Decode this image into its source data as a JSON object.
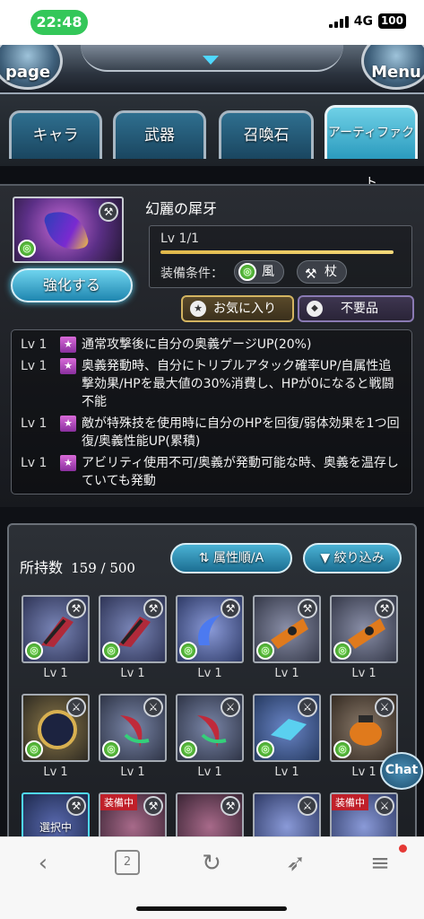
{
  "status_bar": {
    "time": "22:48",
    "network": "4G",
    "battery": "100"
  },
  "header": {
    "left_button": "page",
    "right_button": "Menu"
  },
  "tabs": [
    {
      "label": "キャラ"
    },
    {
      "label": "武器"
    },
    {
      "label": "召喚石"
    },
    {
      "label": "アーティファクト",
      "active": true
    }
  ],
  "detail": {
    "name": "幻麗の犀牙",
    "level": "Lv 1/1",
    "equip_label": "装備条件：",
    "conditions": [
      {
        "icon": "wind-element-icon",
        "label": "風"
      },
      {
        "icon": "staff-weapon-icon",
        "label": "杖"
      }
    ],
    "enhance_button": "強化する",
    "favorite_button": "お気に入り",
    "unneeded_button": "不要品",
    "skills": [
      {
        "lv": "Lv 1",
        "text": "通常攻撃後に自分の奥義ゲージUP(20%)"
      },
      {
        "lv": "Lv 1",
        "text": "奥義発動時、自分にトリプルアタック確率UP/自属性追撃効果/HPを最大値の30%消費し、HPが0になると戦闘不能"
      },
      {
        "lv": "Lv 1",
        "text": "敵が特殊技を使用時に自分のHPを回復/弱体効果を1つ回復/奥義性能UP(累積)"
      },
      {
        "lv": "Lv 1",
        "text": "アビリティ使用不可/奥義が発動可能な時、奥義を温存していても発動"
      }
    ]
  },
  "inventory": {
    "count_label": "所持数",
    "count": "159 / 500",
    "sort_button": "属性順/A",
    "filter_button": "絞り込み",
    "items": [
      {
        "lv": "Lv 1",
        "icon": "fang-blade-icon"
      },
      {
        "lv": "Lv 1",
        "icon": "fang-blade-icon"
      },
      {
        "lv": "Lv 1",
        "icon": "crescent-blade-icon"
      },
      {
        "lv": "Lv 1",
        "icon": "ornate-gauntlet-icon"
      },
      {
        "lv": "Lv 1",
        "icon": "ornate-gauntlet-icon"
      },
      {
        "lv": "Lv 1",
        "icon": "golden-orb-icon"
      },
      {
        "lv": "Lv 1",
        "icon": "twin-claw-icon"
      },
      {
        "lv": "Lv 1",
        "icon": "twin-claw-icon"
      },
      {
        "lv": "Lv 1",
        "icon": "winged-crystal-icon"
      },
      {
        "lv": "Lv 1",
        "icon": "ornate-pot-icon"
      },
      {
        "lv": "",
        "icon": "selected-artifact-icon",
        "tag": "選択中"
      },
      {
        "lv": "",
        "icon": "artifact-icon",
        "tag": "装備中"
      },
      {
        "lv": "",
        "icon": "artifact-icon"
      },
      {
        "lv": "",
        "icon": "artifact-icon"
      },
      {
        "lv": "",
        "icon": "artifact-icon",
        "tag": "装備中"
      }
    ],
    "chat_button": "Chat"
  },
  "browser": {
    "tab_count": "2"
  },
  "colors": {
    "accent": "#2b9bbe",
    "gold": "#d3b461",
    "equipped_red": "#c0202a"
  }
}
